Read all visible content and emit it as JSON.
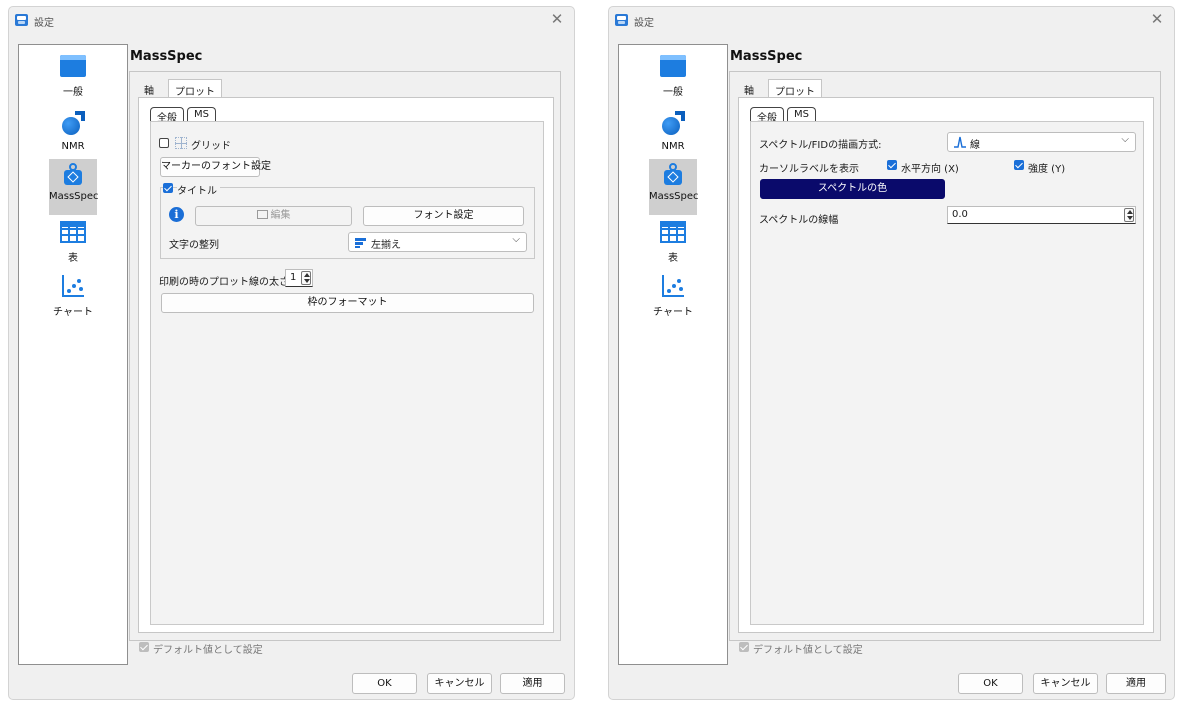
{
  "colors": {
    "accent": "#1a6fd8",
    "spectrum_button_bg": "#0a0a6b",
    "sidebar_active": "#cfcfcf",
    "dialog_bg": "#f0f0f0"
  },
  "dialogs": [
    {
      "title": "設定",
      "panel_title": "MassSpec",
      "sidebar": [
        {
          "label": "一般",
          "icon": "window-icon"
        },
        {
          "label": "NMR",
          "icon": "sphere-arrow-icon"
        },
        {
          "label": "MassSpec",
          "icon": "weight-icon"
        },
        {
          "label": "表",
          "icon": "table-icon"
        },
        {
          "label": "チャート",
          "icon": "scatter-chart-icon"
        }
      ],
      "tabs": [
        "軸",
        "プロット"
      ],
      "subtabs": [
        "全般",
        "MS"
      ],
      "grid_label": "グリッド",
      "marker_font_button": "マーカーのフォント設定",
      "title_group_label": "タイトル",
      "edit_button": "編集",
      "font_settings_button": "フォント設定",
      "text_align_label": "文字の整列",
      "text_align_value": "左揃え",
      "print_line_width_label": "印刷の時のプロット線の太さ",
      "print_line_width_value": "1",
      "frame_format_button": "枠のフォーマット",
      "default_checkbox_label": "デフォルト値として設定",
      "ok": "OK",
      "cancel": "キャンセル",
      "apply": "適用"
    },
    {
      "title": "設定",
      "panel_title": "MassSpec",
      "sidebar": [
        {
          "label": "一般",
          "icon": "window-icon"
        },
        {
          "label": "NMR",
          "icon": "sphere-arrow-icon"
        },
        {
          "label": "MassSpec",
          "icon": "weight-icon"
        },
        {
          "label": "表",
          "icon": "table-icon"
        },
        {
          "label": "チャート",
          "icon": "scatter-chart-icon"
        }
      ],
      "tabs": [
        "軸",
        "プロット"
      ],
      "subtabs": [
        "全般",
        "MS"
      ],
      "draw_mode_label": "スペクトル/FIDの描画方式:",
      "draw_mode_value": "線",
      "cursor_label_text": "カーソルラベルを表示",
      "horizontal_label": "水平方向 (X)",
      "intensity_label": "強度 (Y)",
      "spectrum_color_button": "スペクトルの色",
      "line_width_label": "スペクトルの線幅",
      "line_width_value": "0.0",
      "default_checkbox_label": "デフォルト値として設定",
      "ok": "OK",
      "cancel": "キャンセル",
      "apply": "適用"
    }
  ]
}
